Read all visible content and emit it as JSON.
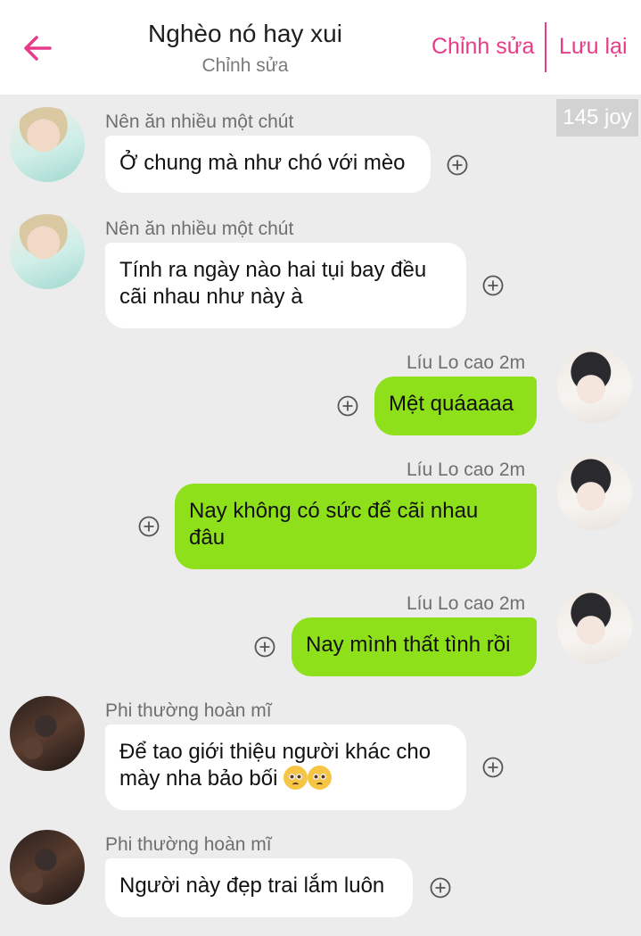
{
  "header": {
    "title": "Nghèo nó hay xui",
    "subtitle": "Chỉnh sửa",
    "edit_label": "Chỉnh sửa",
    "save_label": "Lưu lại"
  },
  "badge": {
    "text": "145 joy"
  },
  "colors": {
    "accent": "#e73b8a",
    "bubble_right": "#8ee01a",
    "bubble_left": "#ffffff",
    "background": "#ececec"
  },
  "messages": [
    {
      "sender": "Nên ăn nhiều một chút",
      "side": "left",
      "lines": [
        "Ở chung mà như chó với mèo"
      ]
    },
    {
      "sender": "Nên ăn nhiều một chút",
      "side": "left",
      "lines": [
        "Tính ra ngày nào hai tụi bay đều",
        "cãi nhau như này à"
      ]
    },
    {
      "sender": "Líu Lo cao 2m",
      "side": "right",
      "lines": [
        "Mệt quáaaaa"
      ]
    },
    {
      "sender": "Líu Lo cao 2m",
      "side": "right",
      "lines": [
        "Nay không có sức để cãi nhau",
        "đâu"
      ]
    },
    {
      "sender": "Líu Lo cao 2m",
      "side": "right",
      "lines": [
        "Nay mình thất tình rồi"
      ]
    },
    {
      "sender": "Phi thường hoàn mĩ",
      "side": "left",
      "lines": [
        "Để tao giới thiệu người khác cho",
        "mày nha bảo bối"
      ],
      "emoji": "pleading-face-emoji"
    },
    {
      "sender": "Phi thường hoàn mĩ",
      "side": "left",
      "lines": [
        "Người này đẹp trai lắm luôn"
      ]
    }
  ]
}
